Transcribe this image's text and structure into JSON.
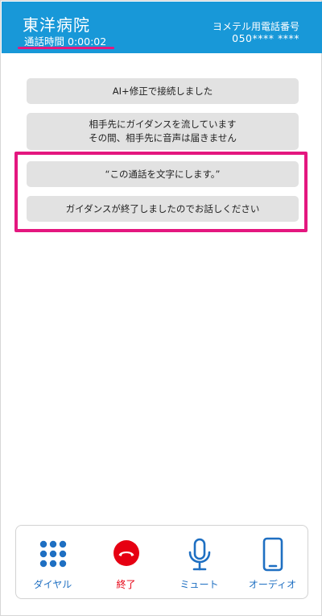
{
  "header": {
    "title": "東洋病院",
    "timer_label": "通話時間",
    "timer_value": "0:00:02",
    "service_name": "ヨメテル用電話番号",
    "phone_number": "050**** ****"
  },
  "messages": {
    "m1": "AI+修正で接続しました",
    "m2_line1": "相手先にガイダンスを流しています",
    "m2_line2": "その間、相手先に音声は届きません",
    "m3": "“この通話を文字にします。”",
    "m4": "ガイダンスが終了しましたのでお話しください"
  },
  "bottom_bar": {
    "dial_label": "ダイヤル",
    "end_label": "終了",
    "mute_label": "ミュート",
    "audio_label": "オーディオ"
  },
  "colors": {
    "header": "#1898d8",
    "highlight": "#e4177f",
    "end_red": "#e60012",
    "icon_blue": "#1e6fc2"
  },
  "icons": {
    "dial": "keypad-icon",
    "end": "hang-up-icon",
    "mute": "microphone-icon",
    "audio": "smartphone-icon"
  }
}
